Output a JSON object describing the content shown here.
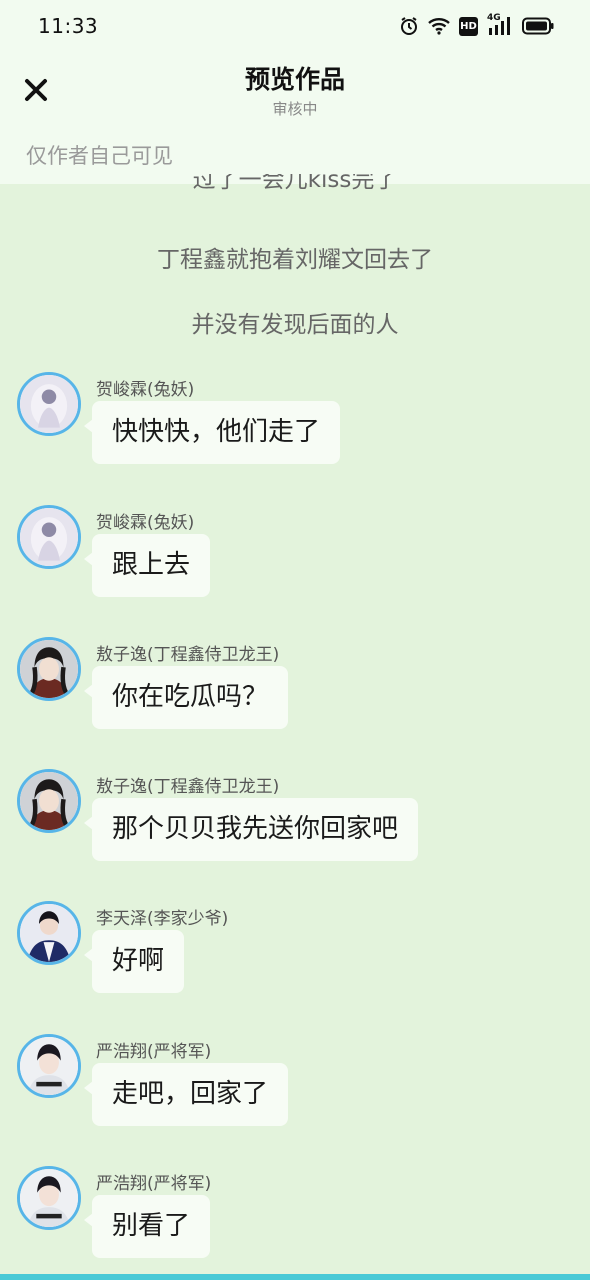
{
  "status_bar": {
    "time": "11:33",
    "icons": [
      "alarm-icon",
      "wifi-icon",
      "hd-icon",
      "signal-4g-icon",
      "battery-icon"
    ],
    "hd_label": "HD",
    "network_label": "4G"
  },
  "header": {
    "close_icon": "close-icon",
    "title": "预览作品",
    "subtitle": "审核中",
    "visibility_note": "仅作者自己可见"
  },
  "narration": [
    "过了一会儿kiss完了",
    "丁程鑫就抱着刘耀文回去了",
    "并没有发现后面的人"
  ],
  "messages": [
    {
      "sender": "贺峻霖(兔妖)",
      "text": "快快快，他们走了"
    },
    {
      "sender": "贺峻霖(兔妖)",
      "text": "跟上去"
    },
    {
      "sender": "敖子逸(丁程鑫侍卫龙王)",
      "text": "你在吃瓜吗？"
    },
    {
      "sender": "敖子逸(丁程鑫侍卫龙王)",
      "text": "那个贝贝我先送你回家吧"
    },
    {
      "sender": "李天泽(李家少爷)",
      "text": "好啊"
    },
    {
      "sender": "严浩翔(严将军)",
      "text": "走吧，回家了"
    },
    {
      "sender": "严浩翔(严将军)",
      "text": "别看了"
    }
  ],
  "colors": {
    "background": "#e3f3dc",
    "header_background": "#f2fbf0",
    "bubble": "#f7fcf5",
    "avatar_border": "#57b5e8",
    "bottom_accent": "#49c9d6"
  }
}
